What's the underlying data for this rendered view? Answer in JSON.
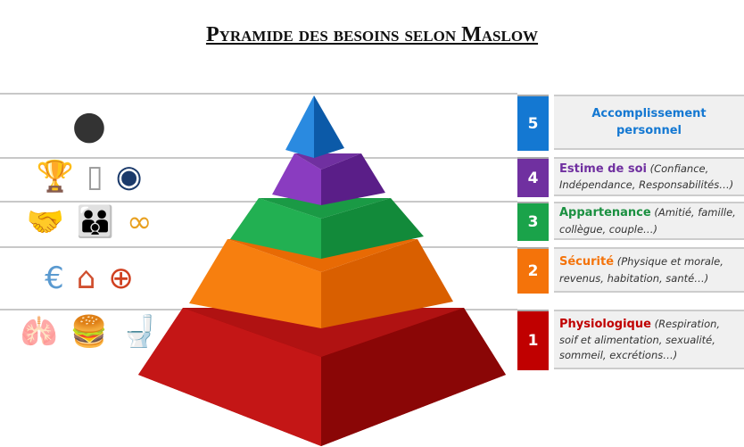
{
  "title": "Pyramide des besoins selon Maslow",
  "colors": {
    "1": "#c00000",
    "2": "#f4730a",
    "3": "#1aa34a",
    "4": "#7030a0",
    "5": "#1478d2"
  },
  "levels": [
    {
      "num": "5",
      "name": "Accomplissement personnel",
      "desc": "",
      "icons": [
        "stacked-stones-icon"
      ]
    },
    {
      "num": "4",
      "name": "Estime de soi",
      "desc": "(Confiance, Indépendance, Responsabilités…)",
      "icons": [
        "trophy-icon",
        "mirror-icon",
        "family-protection-icon"
      ]
    },
    {
      "num": "3",
      "name": "Appartenance",
      "desc": "(Amitié, famille, collègue, couple…)",
      "icons": [
        "handshake-icon",
        "family-icon",
        "rings-icon"
      ]
    },
    {
      "num": "2",
      "name": "Sécurité",
      "desc": "(Physique et morale, revenus, habitation, santé…)",
      "icons": [
        "money-bag-icon",
        "house-icon",
        "medical-icon"
      ]
    },
    {
      "num": "1",
      "name": "Physiologique",
      "desc": "(Respiration, soif et alimentation, sexualité, sommeil, excrétions…)",
      "icons": [
        "lungs-icon",
        "food-drink-icon",
        "toilet-icon"
      ]
    }
  ]
}
